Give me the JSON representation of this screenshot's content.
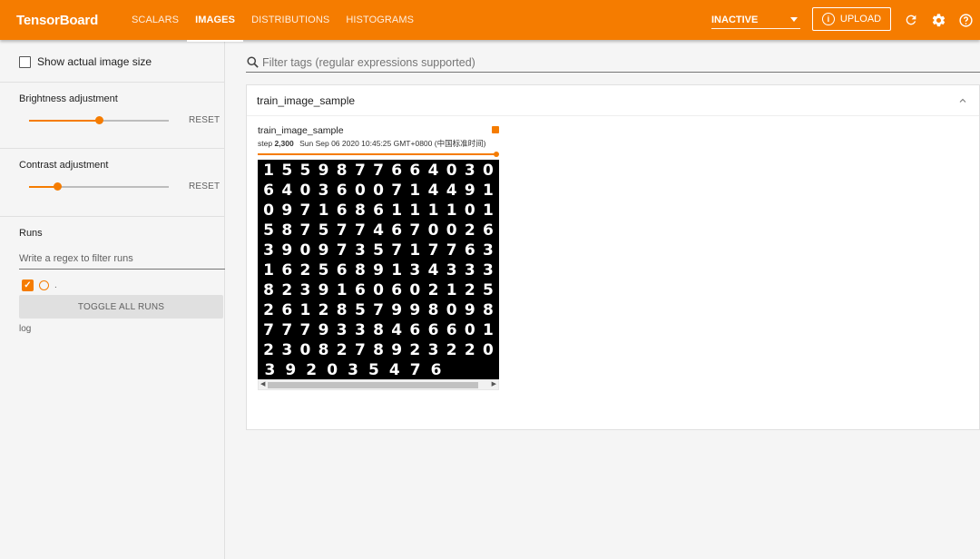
{
  "header": {
    "brand": "TensorBoard",
    "tabs": [
      {
        "label": "SCALARS"
      },
      {
        "label": "IMAGES"
      },
      {
        "label": "DISTRIBUTIONS"
      },
      {
        "label": "HISTOGRAMS"
      }
    ],
    "active_tab": "IMAGES",
    "status_select": "INACTIVE",
    "upload_label": "UPLOAD",
    "upload_icon": "info-icon",
    "icons": [
      "refresh-icon",
      "gear-icon",
      "help-icon"
    ],
    "accent_color": "#f57c00"
  },
  "sidebar": {
    "show_actual_size_label": "Show actual image size",
    "show_actual_size_checked": false,
    "brightness": {
      "label": "Brightness adjustment",
      "reset_label": "RESET",
      "level_percent": 50
    },
    "contrast": {
      "label": "Contrast adjustment",
      "reset_label": "RESET",
      "level_percent": 20
    },
    "runs": {
      "title": "Runs",
      "filter_placeholder": "Write a regex to filter runs",
      "items": [
        {
          "name": ".",
          "checked": true
        }
      ],
      "toggle_label": "TOGGLE ALL RUNS",
      "log_dir": "log"
    }
  },
  "main": {
    "filter_placeholder": "Filter tags (regular expressions supported)",
    "card": {
      "tag": "train_image_sample",
      "image": {
        "title": "train_image_sample",
        "step_label": "step",
        "step_value": "2,300",
        "timestamp": "Sun Sep 06 2020 10:45:25 GMT+0800 (中国标准时间)",
        "step_slider_percent": 100,
        "digit_rows": [
          "1559877664030",
          "6403600714491",
          "0971686111101",
          "5875774670026",
          "3909735717763",
          "1625689134333",
          "8239160602125",
          "2612857998098",
          "7779338466601",
          "2308278923220",
          "392035476"
        ]
      }
    }
  }
}
